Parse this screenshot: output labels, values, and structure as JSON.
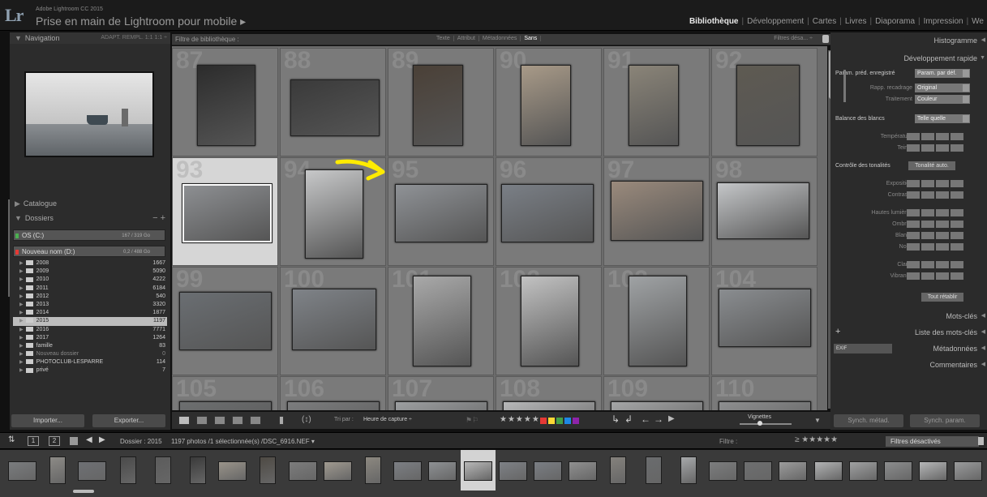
{
  "app": {
    "logo": "Lr",
    "version": "Adobe Lightroom CC 2015",
    "catalog_title": "Prise en main de Lightroom pour mobile ▸"
  },
  "modules": [
    "Bibliothèque",
    "Développement",
    "Cartes",
    "Livres",
    "Diaporama",
    "Impression",
    "We"
  ],
  "active_module": "Bibliothèque",
  "left_panel": {
    "navigator": {
      "title": "Navigation",
      "options": "ADAPT.  REMPL.  1:1  1:1 ÷"
    },
    "catalog_label": "Catalogue",
    "folders_label": "Dossiers",
    "folders_plus": "− +",
    "volumes": [
      {
        "name": "OS (C:)",
        "info": "167 / 319 Go",
        "color": "#4caf50"
      },
      {
        "name": "Nouveau nom (D:)",
        "info": "0,2 / 488 Go",
        "color": "#e53935"
      }
    ],
    "folders": [
      {
        "name": "2008",
        "count": "1667"
      },
      {
        "name": "2009",
        "count": "5090"
      },
      {
        "name": "2010",
        "count": "4222"
      },
      {
        "name": "2011",
        "count": "6184"
      },
      {
        "name": "2012",
        "count": "540"
      },
      {
        "name": "2013",
        "count": "3320"
      },
      {
        "name": "2014",
        "count": "1877"
      },
      {
        "name": "2015",
        "count": "1197"
      },
      {
        "name": "2016",
        "count": "7771"
      },
      {
        "name": "2017",
        "count": "1264"
      },
      {
        "name": "famille",
        "count": "83"
      },
      {
        "name": "Nouveau dossier",
        "count": "0"
      },
      {
        "name": "PHOTOCLUB-LESPARRE",
        "count": "114"
      },
      {
        "name": "privé",
        "count": "7"
      }
    ],
    "selected_folder": "2015",
    "import_label": "Importer...",
    "export_label": "Exporter..."
  },
  "filter_bar": {
    "label": "Filtre de bibliothèque :",
    "tabs": [
      "Texte",
      "Attribut",
      "Métadonnées",
      "Sans"
    ],
    "active_tab": "Sans",
    "preset": "Filtres désa... ÷"
  },
  "grid": {
    "cells": [
      {
        "num": "87",
        "tone": "#2c2c2c"
      },
      {
        "num": "88",
        "tone": "#3a3a3a"
      },
      {
        "num": "89",
        "tone": "#4a4037"
      },
      {
        "num": "90",
        "tone": "#a89a88"
      },
      {
        "num": "91",
        "tone": "#8a8478"
      },
      {
        "num": "92",
        "tone": "#5e5a52"
      },
      {
        "num": "93",
        "tone": "#8d8f92"
      },
      {
        "num": "94",
        "tone": "#c7c8c9"
      },
      {
        "num": "95",
        "tone": "#8f9296"
      },
      {
        "num": "96",
        "tone": "#7a7f86"
      },
      {
        "num": "97",
        "tone": "#9a8a7c"
      },
      {
        "num": "98",
        "tone": "#c4c6c8"
      },
      {
        "num": "99",
        "tone": "#6a6e72"
      },
      {
        "num": "100",
        "tone": "#7f8388"
      },
      {
        "num": "101",
        "tone": "#a9a9a9"
      },
      {
        "num": "102",
        "tone": "#c2c2c2"
      },
      {
        "num": "103",
        "tone": "#9fa2a4"
      },
      {
        "num": "104",
        "tone": "#8a8d90"
      },
      {
        "num": "105",
        "tone": "#6d6f70"
      },
      {
        "num": "106",
        "tone": "#7c7d7e"
      },
      {
        "num": "107",
        "tone": "#9d9fa1"
      },
      {
        "num": "108",
        "tone": "#b7b8b9"
      },
      {
        "num": "109",
        "tone": "#a5a6a7"
      },
      {
        "num": "110",
        "tone": "#8e8f90"
      }
    ],
    "selected_num": "93"
  },
  "toolbar": {
    "sort_label": "Tri par :",
    "sort_value": "Heure de capture ÷",
    "stars": "★★★★★",
    "labels": [
      "#e53935",
      "#fdd835",
      "#43a047",
      "#1e88e5",
      "#8e24aa"
    ],
    "thumbnails_label": "Vignettes"
  },
  "right_panel": {
    "histogram": "Histogramme",
    "quick_develop": "Développement rapide",
    "saved_preset_label": "Param. préd. enregistré",
    "saved_preset_value": "Param. par déf.",
    "crop_label": "Rapp. recadrage",
    "crop_value": "Original",
    "treatment_label": "Traitement",
    "treatment_value": "Couleur",
    "wb_label": "Balance des blancs",
    "wb_value": "Telle quelle",
    "temperature": "Température",
    "tint": "Teinte",
    "tone_label": "Contrôle des tonalités",
    "auto_tone": "Tonalité auto.",
    "exposure": "Exposition",
    "contrast": "Contraste",
    "highlights": "Hautes lumières",
    "shadows": "Ombres",
    "whites": "Blancs",
    "blacks": "Noirs",
    "clarity": "Clarté",
    "vibrance": "Vibrance",
    "reset_all": "Tout rétablir",
    "keywords": "Mots-clés",
    "keyword_list": "Liste des mots-clés",
    "exif": "EXIF",
    "metadata": "Métadonnées",
    "comments": "Commentaires",
    "sync_meta": "Synch. métad.",
    "sync_params": "Synch. param."
  },
  "status_bar": {
    "screen1": "1",
    "screen2": "2",
    "folder": "Dossier : 2015",
    "count": "1197 photos /1 sélectionnée(s) /DSC_6916.NEF ▾",
    "filter_label": "Filtre :",
    "stars": "≥ ★★★★★",
    "filter_select": "Filtres désactivés"
  },
  "filmstrip": {
    "tones": [
      "#7a7c7e",
      "#8c8a86",
      "#6e7074",
      "#4a4a4a",
      "#5c5c5c",
      "#3a3a3a",
      "#9a948a",
      "#4e4a44",
      "#7c7c7c",
      "#a09a90",
      "#8c8880",
      "#7c7f84",
      "#8e9194",
      "#b8b8b8",
      "#7e8186",
      "#7a7e84",
      "#909090",
      "#84817c",
      "#6a6c6e",
      "#a6a8aa",
      "#7c7d7e",
      "#6e6f70",
      "#9c9c9c",
      "#b2b3b4",
      "#a0a1a2",
      "#8c8d8e",
      "#b6b7b8",
      "#9a9b9c"
    ]
  }
}
